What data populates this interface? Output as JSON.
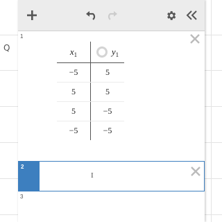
{
  "toolbar": {
    "add_icon": "plus-icon",
    "undo_icon": "undo-icon",
    "redo_icon": "redo-icon",
    "settings_icon": "gear-icon",
    "collapse_icon": "double-chevron-left-icon"
  },
  "expressions": [
    {
      "number": "1",
      "type": "table",
      "columns": [
        {
          "var": "x",
          "sub": "1"
        },
        {
          "var": "y",
          "sub": "1"
        }
      ],
      "rows": [
        [
          "−5",
          "5"
        ],
        [
          "5",
          "5"
        ],
        [
          "5",
          "−5"
        ],
        [
          "−5",
          "−5"
        ]
      ]
    },
    {
      "number": "2",
      "type": "input",
      "active": true,
      "cursor": "I"
    },
    {
      "number": "3",
      "type": "empty"
    }
  ],
  "graph": {
    "left_glyph": "Q"
  },
  "colors": {
    "active_accent": "#3d7fbf",
    "toolbar_bg": "#ececec",
    "icon_gray": "#555555",
    "close_gray": "#bbbbbb"
  }
}
